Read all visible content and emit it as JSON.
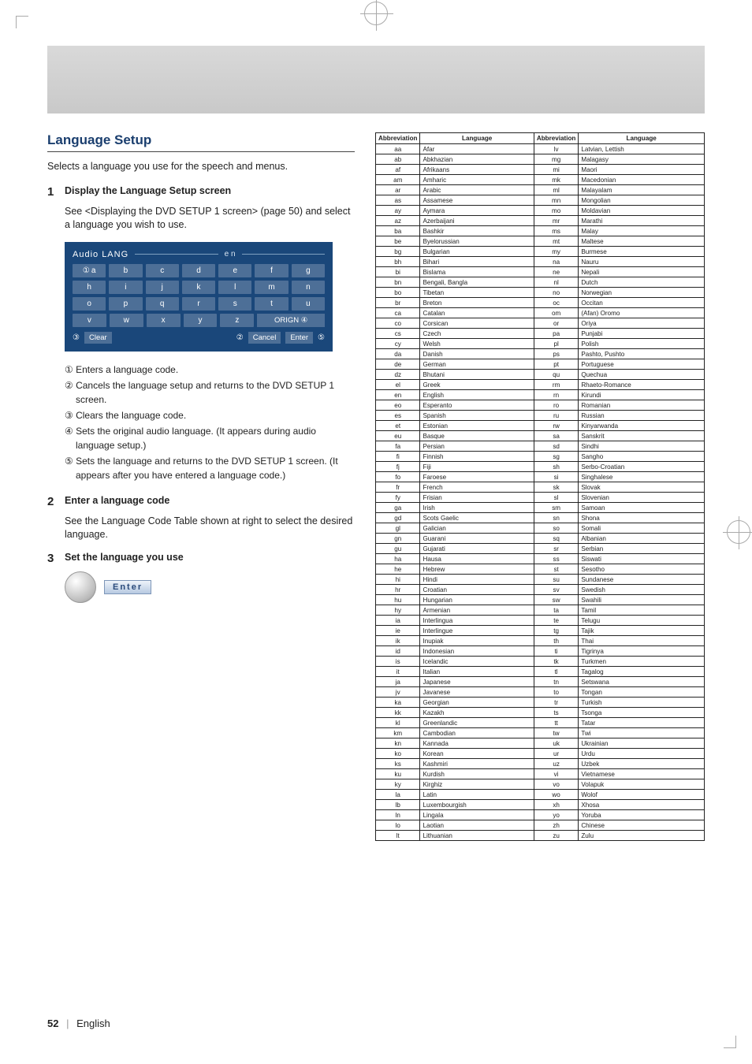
{
  "header": {
    "title": "Language Setup"
  },
  "intro": "Selects a language you use for the speech and menus.",
  "steps": [
    {
      "n": "1",
      "head": "Display the Language Setup screen",
      "body": "See <Displaying the DVD SETUP 1 screen> (page 50) and select a language you wish to use."
    },
    {
      "n": "2",
      "head": "Enter a language code",
      "body": "See the Language Code Table shown at right to select the desired language."
    },
    {
      "n": "3",
      "head": "Set the language you use",
      "body": ""
    }
  ],
  "panel": {
    "top_label": "Audio  LANG",
    "preview": "e n",
    "rows": [
      [
        "a",
        "b",
        "c",
        "d",
        "e",
        "f",
        "g"
      ],
      [
        "h",
        "i",
        "j",
        "k",
        "l",
        "m",
        "n"
      ],
      [
        "o",
        "p",
        "q",
        "r",
        "s",
        "t",
        "u"
      ],
      [
        "v",
        "w",
        "x",
        "y",
        "z"
      ]
    ],
    "orig_label": "ORIGN",
    "clear_label": "Clear",
    "cancel_label": "Cancel",
    "enter_label": "Enter"
  },
  "callouts": [
    "① Enters a language code.",
    "② Cancels the language setup and returns to the DVD SETUP 1 screen.",
    "③ Clears the language code.",
    "④ Sets the original audio language. (It appears during audio language setup.)",
    "⑤ Sets the language and returns to the DVD SETUP 1 screen. (It appears after you have entered a language code.)"
  ],
  "enter_btn": "Enter",
  "table": {
    "headers": [
      "Abbreviation",
      "Language",
      "Abbreviation",
      "Language"
    ],
    "rows": [
      [
        "aa",
        "Afar",
        "lv",
        "Latvian, Lettish"
      ],
      [
        "ab",
        "Abkhazian",
        "mg",
        "Malagasy"
      ],
      [
        "af",
        "Afrikaans",
        "mi",
        "Maori"
      ],
      [
        "am",
        "Amharic",
        "mk",
        "Macedonian"
      ],
      [
        "ar",
        "Arabic",
        "ml",
        "Malayalam"
      ],
      [
        "as",
        "Assamese",
        "mn",
        "Mongolian"
      ],
      [
        "ay",
        "Aymara",
        "mo",
        "Moldavian"
      ],
      [
        "az",
        "Azerbaijani",
        "mr",
        "Marathi"
      ],
      [
        "ba",
        "Bashkir",
        "ms",
        "Malay"
      ],
      [
        "be",
        "Byelorussian",
        "mt",
        "Maltese"
      ],
      [
        "bg",
        "Bulgarian",
        "my",
        "Burmese"
      ],
      [
        "bh",
        "Bihari",
        "na",
        "Nauru"
      ],
      [
        "bi",
        "Bislama",
        "ne",
        "Nepali"
      ],
      [
        "bn",
        "Bengali, Bangla",
        "nl",
        "Dutch"
      ],
      [
        "bo",
        "Tibetan",
        "no",
        "Norwegian"
      ],
      [
        "br",
        "Breton",
        "oc",
        "Occitan"
      ],
      [
        "ca",
        "Catalan",
        "om",
        "(Afan) Oromo"
      ],
      [
        "co",
        "Corsican",
        "or",
        "Oriya"
      ],
      [
        "cs",
        "Czech",
        "pa",
        "Punjabi"
      ],
      [
        "cy",
        "Welsh",
        "pl",
        "Polish"
      ],
      [
        "da",
        "Danish",
        "ps",
        "Pashto, Pushto"
      ],
      [
        "de",
        "German",
        "pt",
        "Portuguese"
      ],
      [
        "dz",
        "Bhutani",
        "qu",
        "Quechua"
      ],
      [
        "el",
        "Greek",
        "rm",
        "Rhaeto-Romance"
      ],
      [
        "en",
        "English",
        "rn",
        "Kirundi"
      ],
      [
        "eo",
        "Esperanto",
        "ro",
        "Romanian"
      ],
      [
        "es",
        "Spanish",
        "ru",
        "Russian"
      ],
      [
        "et",
        "Estonian",
        "rw",
        "Kinyarwanda"
      ],
      [
        "eu",
        "Basque",
        "sa",
        "Sanskrit"
      ],
      [
        "fa",
        "Persian",
        "sd",
        "Sindhi"
      ],
      [
        "fi",
        "Finnish",
        "sg",
        "Sangho"
      ],
      [
        "fj",
        "Fiji",
        "sh",
        "Serbo-Croatian"
      ],
      [
        "fo",
        "Faroese",
        "si",
        "Singhalese"
      ],
      [
        "fr",
        "French",
        "sk",
        "Slovak"
      ],
      [
        "fy",
        "Frisian",
        "sl",
        "Slovenian"
      ],
      [
        "ga",
        "Irish",
        "sm",
        "Samoan"
      ],
      [
        "gd",
        "Scots Gaelic",
        "sn",
        "Shona"
      ],
      [
        "gl",
        "Galician",
        "so",
        "Somali"
      ],
      [
        "gn",
        "Guarani",
        "sq",
        "Albanian"
      ],
      [
        "gu",
        "Gujarati",
        "sr",
        "Serbian"
      ],
      [
        "ha",
        "Hausa",
        "ss",
        "Siswati"
      ],
      [
        "he",
        "Hebrew",
        "st",
        "Sesotho"
      ],
      [
        "hi",
        "Hindi",
        "su",
        "Sundanese"
      ],
      [
        "hr",
        "Croatian",
        "sv",
        "Swedish"
      ],
      [
        "hu",
        "Hungarian",
        "sw",
        "Swahili"
      ],
      [
        "hy",
        "Armenian",
        "ta",
        "Tamil"
      ],
      [
        "ia",
        "Interlingua",
        "te",
        "Telugu"
      ],
      [
        "ie",
        "Interlingue",
        "tg",
        "Tajik"
      ],
      [
        "ik",
        "Inupiak",
        "th",
        "Thai"
      ],
      [
        "id",
        "Indonesian",
        "ti",
        "Tigrinya"
      ],
      [
        "is",
        "Icelandic",
        "tk",
        "Turkmen"
      ],
      [
        "it",
        "Italian",
        "tl",
        "Tagalog"
      ],
      [
        "ja",
        "Japanese",
        "tn",
        "Setswana"
      ],
      [
        "jv",
        "Javanese",
        "to",
        "Tongan"
      ],
      [
        "ka",
        "Georgian",
        "tr",
        "Turkish"
      ],
      [
        "kk",
        "Kazakh",
        "ts",
        "Tsonga"
      ],
      [
        "kl",
        "Greenlandic",
        "tt",
        "Tatar"
      ],
      [
        "km",
        "Cambodian",
        "tw",
        "Twi"
      ],
      [
        "kn",
        "Kannada",
        "uk",
        "Ukrainian"
      ],
      [
        "ko",
        "Korean",
        "ur",
        "Urdu"
      ],
      [
        "ks",
        "Kashmiri",
        "uz",
        "Uzbek"
      ],
      [
        "ku",
        "Kurdish",
        "vi",
        "Vietnamese"
      ],
      [
        "ky",
        "Kirghiz",
        "vo",
        "Volapuk"
      ],
      [
        "la",
        "Latin",
        "wo",
        "Wolof"
      ],
      [
        "lb",
        "Luxembourgish",
        "xh",
        "Xhosa"
      ],
      [
        "ln",
        "Lingala",
        "yo",
        "Yoruba"
      ],
      [
        "lo",
        "Laotian",
        "zh",
        "Chinese"
      ],
      [
        "lt",
        "Lithuanian",
        "zu",
        "Zulu"
      ]
    ]
  },
  "footer": {
    "page": "52",
    "lang": "English"
  }
}
